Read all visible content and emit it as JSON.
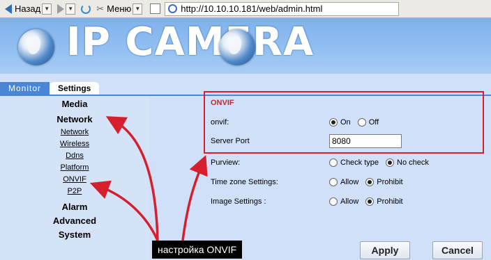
{
  "browser": {
    "back_label": "Назад",
    "menu_label": "Меню",
    "url": "http://10.10.10.181/web/admin.html"
  },
  "header": {
    "logo_text": "IP CAMERA"
  },
  "tabs": [
    {
      "label": "Monitor"
    },
    {
      "label": "Settings"
    }
  ],
  "sidebar": {
    "media": "Media",
    "network": "Network",
    "network_items": [
      "Network",
      "Wireless",
      "Ddns",
      "Platform",
      "ONVIF",
      "P2P"
    ],
    "alarm": "Alarm",
    "advanced": "Advanced",
    "system": "System"
  },
  "onvif": {
    "title": "ONVIF",
    "onvif_label": "onvif:",
    "on_label": "On",
    "off_label": "Off",
    "onvif_selected": "On",
    "port_label": "Server Port",
    "port_value": "8080",
    "purview_label": "Purview:",
    "check_type_label": "Check type",
    "no_check_label": "No check",
    "purview_selected": "No check",
    "timezone_label": "Time zone Settings:",
    "allow_label": "Allow",
    "prohibit_label": "Prohibit",
    "timezone_selected": "Prohibit",
    "image_label": "Image Settings :",
    "image_selected": "Prohibit"
  },
  "buttons": {
    "apply": "Apply",
    "cancel": "Cancel"
  },
  "annotation": {
    "text": "настройка ONVIF",
    "color": "#d61f2c"
  },
  "colors": {
    "banner": "#94c1f2",
    "sidebar": "#d4e3f8",
    "tab_blue": "#4a86d4",
    "onvif_title": "#c0282e"
  }
}
